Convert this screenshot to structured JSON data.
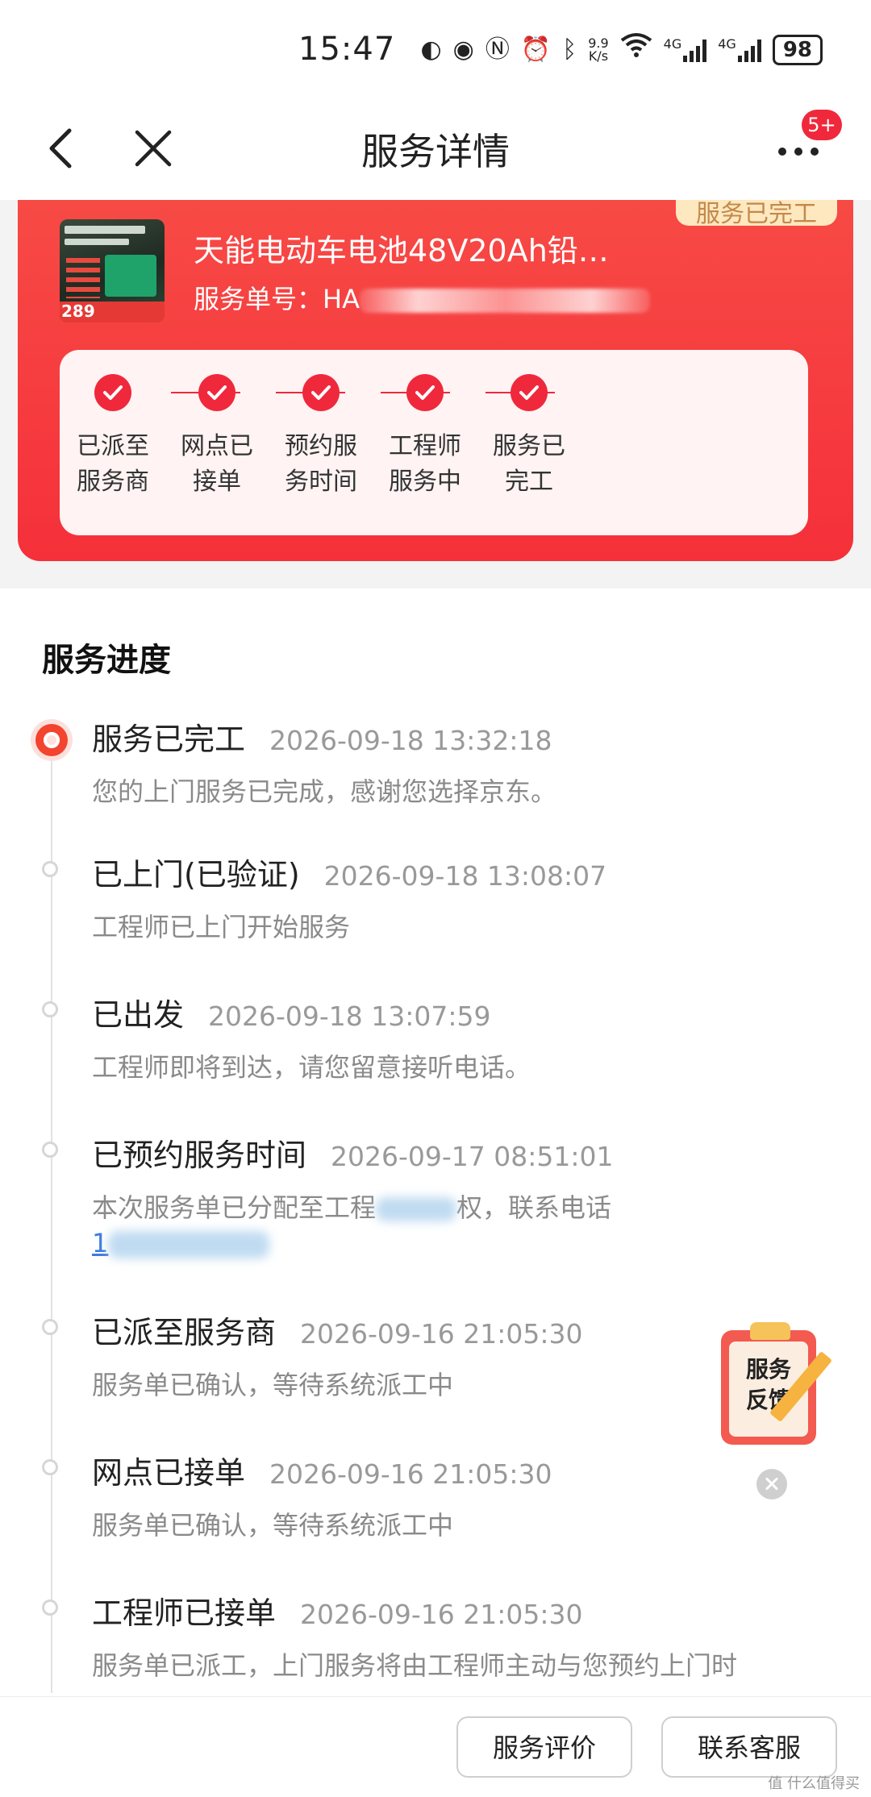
{
  "status_bar": {
    "time": "15:47",
    "speed_top": "9.9",
    "speed_bottom": "K/s",
    "net1": "4G",
    "net2": "4G",
    "battery": "98"
  },
  "nav": {
    "title": "服务详情",
    "badge": "5+"
  },
  "card": {
    "status_tag": "服务已完工",
    "product_name": "天能电动车电池48V20Ah铅…",
    "order_label": "服务单号：",
    "order_visible": "HA",
    "thumb_price": "289",
    "steps": [
      {
        "line1": "已派至",
        "line2": "服务商"
      },
      {
        "line1": "网点已",
        "line2": "接单"
      },
      {
        "line1": "预约服",
        "line2": "务时间"
      },
      {
        "line1": "工程师",
        "line2": "服务中"
      },
      {
        "line1": "服务已",
        "line2": "完工"
      }
    ]
  },
  "progress": {
    "title": "服务进度",
    "items": [
      {
        "title": "服务已完工",
        "time": "2026-09-18 13:32:18",
        "desc": "您的上门服务已完成，感谢您选择京东。"
      },
      {
        "title": "已上门(已验证)",
        "time": "2026-09-18 13:08:07",
        "desc": "工程师已上门开始服务"
      },
      {
        "title": "已出发",
        "time": "2026-09-18 13:07:59",
        "desc": "工程师即将到达，请您留意接听电话。"
      },
      {
        "title": "已预约服务时间",
        "time": "2026-09-17 08:51:01",
        "desc_a": "本次服务单已分配至工程",
        "desc_b": "权，联系电话",
        "phone": "1"
      },
      {
        "title": "已派至服务商",
        "time": "2026-09-16 21:05:30",
        "desc": "服务单已确认，等待系统派工中"
      },
      {
        "title": "网点已接单",
        "time": "2026-09-16 21:05:30",
        "desc": "服务单已确认，等待系统派工中"
      },
      {
        "title": "工程师已接单",
        "time": "2026-09-16 21:05:30",
        "desc": "服务单已派工，上门服务将由工程师主动与您预约上门时"
      }
    ]
  },
  "feedback": {
    "line1": "服务",
    "line2": "反馈"
  },
  "bottom": {
    "review_btn": "服务评价",
    "contact_btn": "联系客服",
    "watermark": "值 什么值得买"
  }
}
